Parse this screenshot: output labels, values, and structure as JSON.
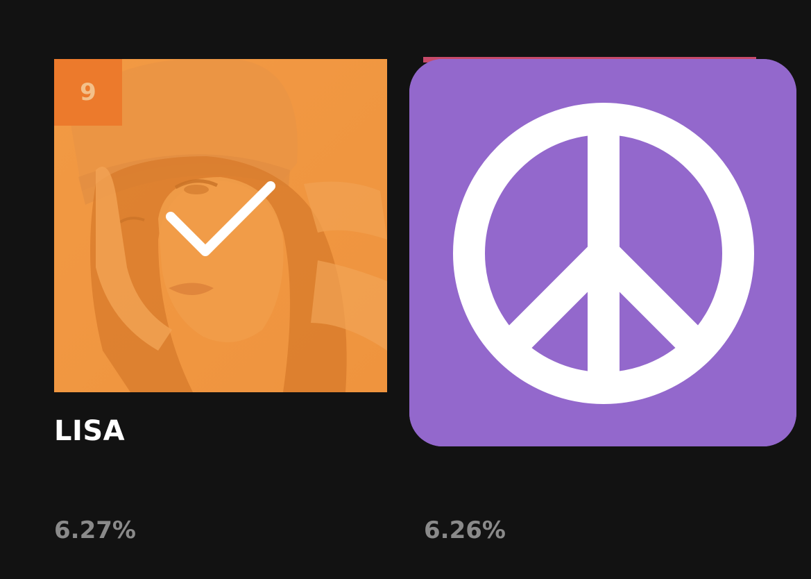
{
  "cards": [
    {
      "rank": "9",
      "name": "LISA",
      "percent": "6.27%",
      "selected": true,
      "overlay_color": "#f0963c",
      "badge_color": "#ec7a2c",
      "icon": "check-icon"
    },
    {
      "rank": "",
      "name": "",
      "percent": "6.26%",
      "icon": "peace-symbol-icon",
      "tile_color": "#9368cc",
      "symbol_color": "#ffffff"
    }
  ],
  "colors": {
    "background": "#121212",
    "name_text": "#ffffff",
    "percent_text": "#8a8a8a"
  }
}
